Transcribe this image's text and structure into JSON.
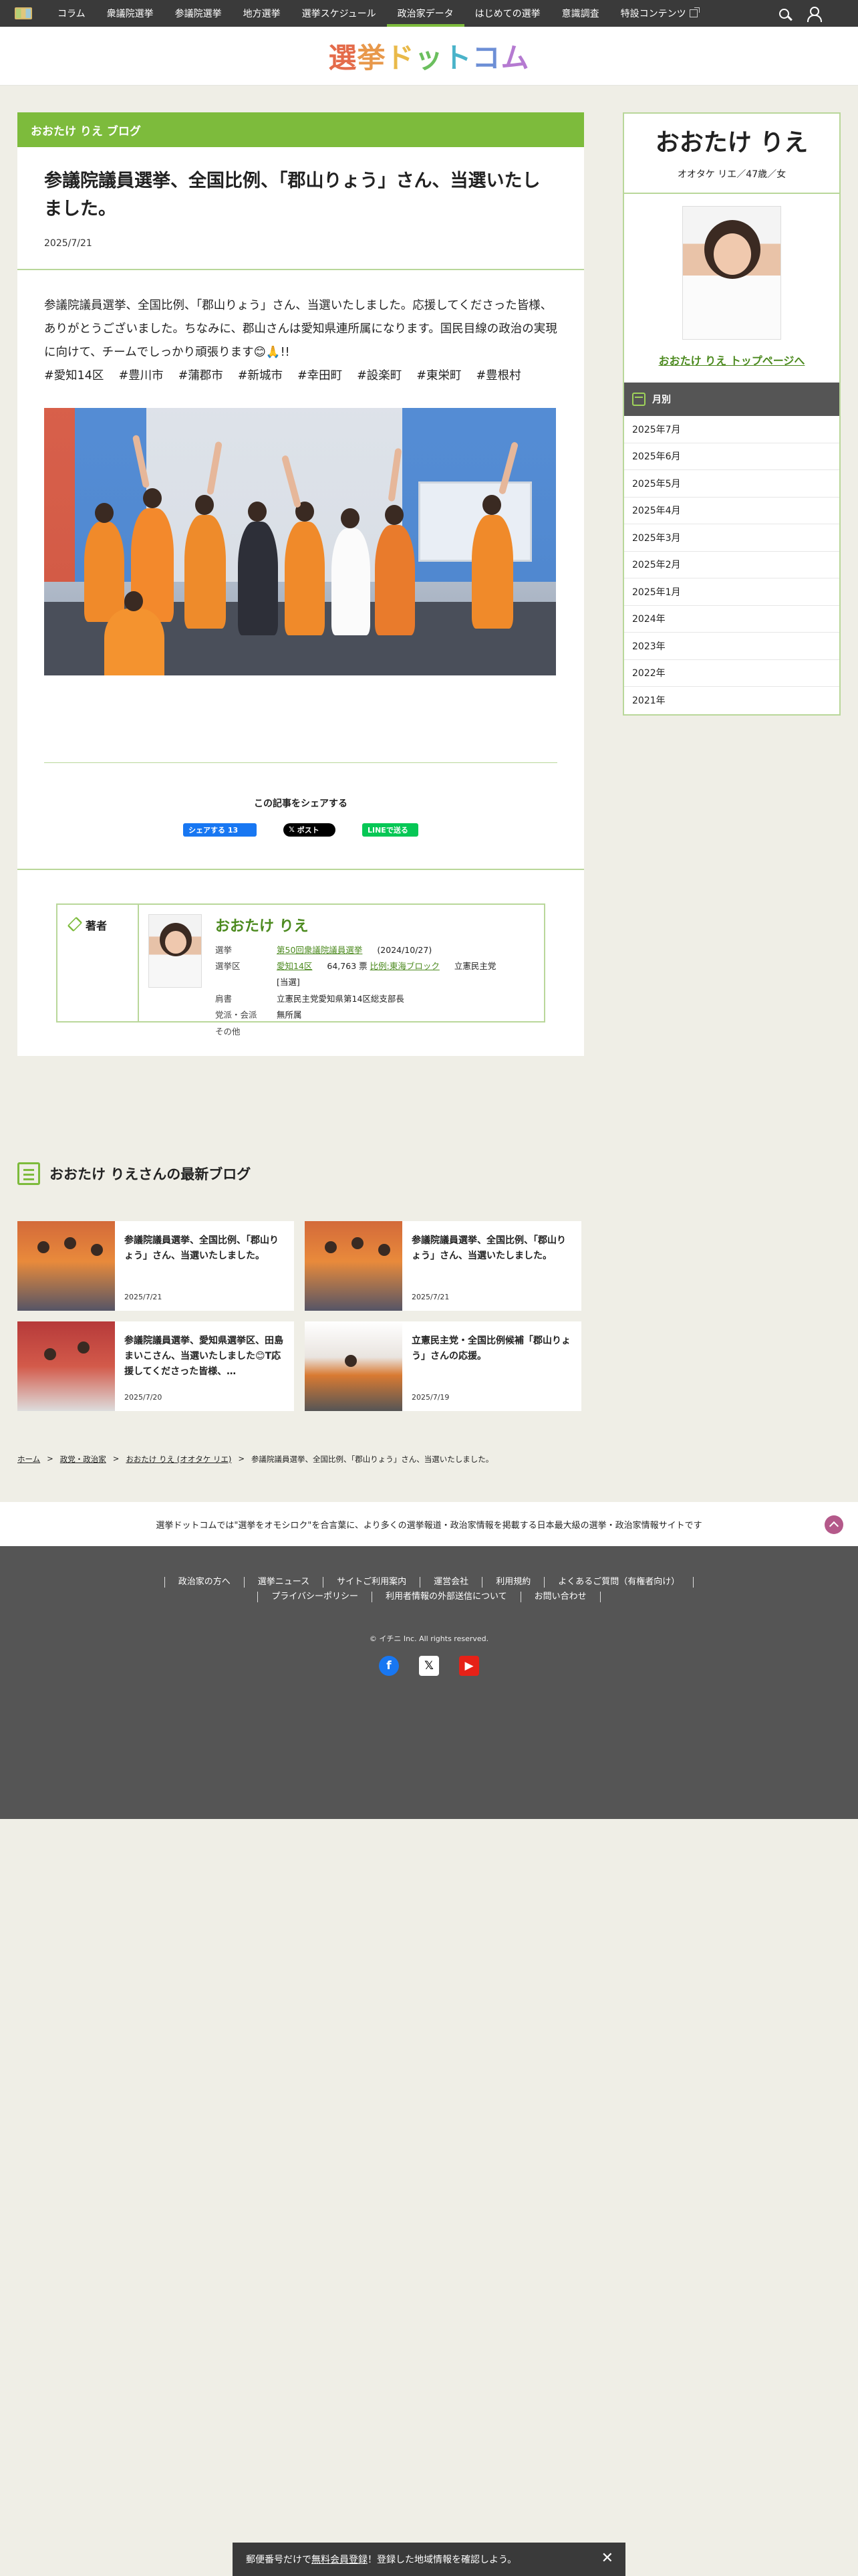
{
  "nav": {
    "items": [
      "コラム",
      "衆議院選挙",
      "参議院選挙",
      "地方選挙",
      "選挙スケジュール",
      "政治家データ",
      "はじめての選挙",
      "意識調査",
      "特設コンテンツ"
    ],
    "active_index": 5
  },
  "logo": {
    "chars": [
      "選",
      "挙",
      "ド",
      "ッ",
      "ト",
      "コ",
      "ム"
    ]
  },
  "blog": {
    "header": "おおたけ りえ ブログ",
    "title": "参議院議員選挙、全国比例、「郡山りょう」さん、当選いたしました。",
    "date": "2025/7/21",
    "body": "参議院議員選挙、全国比例、「郡山りょう」さん、当選いたしました。応援してくださった皆様、ありがとうございました。ちなみに、郡山さんは愛知県連所属になります。国民目線の政治の実現に向けて、チームでしっかり頑張ります😊🙏!!",
    "hashtags": [
      "#愛知14区",
      "#豊川市",
      "#蒲郡市",
      "#新城市",
      "#幸田町",
      "#設楽町",
      "#東栄町",
      "#豊根村"
    ]
  },
  "share": {
    "title": "この記事をシェアする",
    "fb_label": "シェアする 13",
    "x_label": "ポスト",
    "line_label": "LINEで送る"
  },
  "author": {
    "label": "著者",
    "name": "おおたけ りえ",
    "rows": {
      "election_k": "選挙",
      "election_v": "第50回衆議院議員選挙",
      "election_date": "(2024/10/27)",
      "district_k": "選挙区",
      "district_v": "愛知14区",
      "votes": "64,763 票",
      "block": "比例:東海ブロック",
      "party": "立憲民主党",
      "result": "[当選]",
      "title_k": "肩書",
      "title_v": "立憲民主党愛知県第14区総支部長",
      "faction_k": "党派・会派",
      "faction_v": "無所属",
      "other_k": "その他"
    }
  },
  "sidebar": {
    "name": "おおたけ りえ",
    "kana": "オオタケ リエ／47歳／女",
    "link": "おおたけ りえ トップページへ",
    "monthly_label": "月別",
    "months": [
      "2025年7月",
      "2025年6月",
      "2025年5月",
      "2025年4月",
      "2025年3月",
      "2025年2月",
      "2025年1月",
      "2024年",
      "2023年",
      "2022年",
      "2021年"
    ]
  },
  "latest": {
    "title": "おおたけ りえさんの最新ブログ",
    "cards": [
      {
        "title": "参議院議員選挙、全国比例、「郡山りょう」さん、当選いたしました。",
        "date": "2025/7/21"
      },
      {
        "title": "参議院議員選挙、全国比例、「郡山りょう」さん、当選いたしました。",
        "date": "2025/7/21"
      },
      {
        "title": "参議院議員選挙、愛知県選挙区、田島まいこさん、当選いたしました😊T応援してくださった皆様、…",
        "date": "2025/7/20"
      },
      {
        "title": "立憲民主党・全国比例候補「郡山りょう」さんの応援。",
        "date": "2025/7/19"
      }
    ]
  },
  "breadcrumb": {
    "home": "ホーム",
    "politicians": "政党・政治家",
    "person": "おおたけ りえ (オオタケ リエ)",
    "current": "参議院議員選挙、全国比例、「郡山りょう」さん、当選いたしました。"
  },
  "info_band": "選挙ドットコムでは\"選挙をオモシロク\"を合言葉に、より多くの選挙報道・政治家情報を掲載する日本最大級の選挙・政治家情報サイトです",
  "footer": {
    "row1": [
      "政治家の方へ",
      "選挙ニュース",
      "サイトご利用案内",
      "運営会社",
      "利用規約",
      "よくあるご質問（有権者向け）"
    ],
    "row2": [
      "プライバシーポリシー",
      "利用者情報の外部送信について",
      "お問い合わせ"
    ],
    "copyright": "© イチニ Inc. All rights reserved."
  },
  "bottom_bar": {
    "prefix": "郵便番号だけで",
    "link": "無料会員登録",
    "suffix": "！登録した地域情報を確認しよう。"
  }
}
